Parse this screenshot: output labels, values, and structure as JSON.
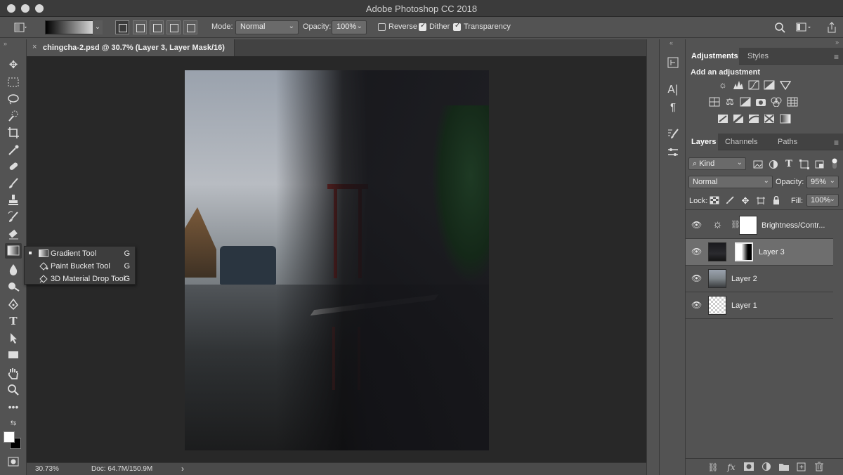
{
  "app": {
    "window_title": "Adobe Photoshop CC 2018"
  },
  "options_bar": {
    "mode_label": "Mode:",
    "mode_value": "Normal",
    "opacity_label": "Opacity:",
    "opacity_value": "100%",
    "reverse_label": "Reverse",
    "reverse_checked": false,
    "dither_label": "Dither",
    "dither_checked": true,
    "transparency_label": "Transparency",
    "transparency_checked": true
  },
  "document": {
    "tab_close": "×",
    "tab_title": "chingcha-2.psd @ 30.7% (Layer 3, Layer Mask/16)"
  },
  "status": {
    "zoom": "30.73%",
    "doc_size": "Doc: 64.7M/150.9M",
    "arrow": "›"
  },
  "tool_flyout": {
    "items": [
      {
        "label": "Gradient Tool",
        "key": "G",
        "selected": true
      },
      {
        "label": "Paint Bucket Tool",
        "key": "G",
        "selected": false
      },
      {
        "label": "3D Material Drop Tool",
        "key": "G",
        "selected": false
      }
    ]
  },
  "adjustments_panel": {
    "tabs": [
      "Adjustments",
      "Styles"
    ],
    "active_tab": "Adjustments",
    "heading": "Add an adjustment"
  },
  "layers_panel": {
    "tabs": [
      "Layers",
      "Channels",
      "Paths"
    ],
    "active_tab": "Layers",
    "filter_value": "Kind",
    "blend_mode": "Normal",
    "opacity_label": "Opacity:",
    "opacity_value": "95%",
    "lock_label": "Lock:",
    "fill_label": "Fill:",
    "fill_value": "100%",
    "layers": [
      {
        "name": "Brightness/Contr...",
        "type": "adjustment",
        "selected": false
      },
      {
        "name": "Layer 3",
        "type": "masked",
        "selected": true
      },
      {
        "name": "Layer 2",
        "type": "image",
        "selected": false
      },
      {
        "name": "Layer 1",
        "type": "transparent",
        "selected": false
      }
    ]
  },
  "colors": {
    "panel_bg": "#535353",
    "canvas_bg": "#282828",
    "selected_layer": "#6e6e6e",
    "swing_red": "#c23a36"
  }
}
